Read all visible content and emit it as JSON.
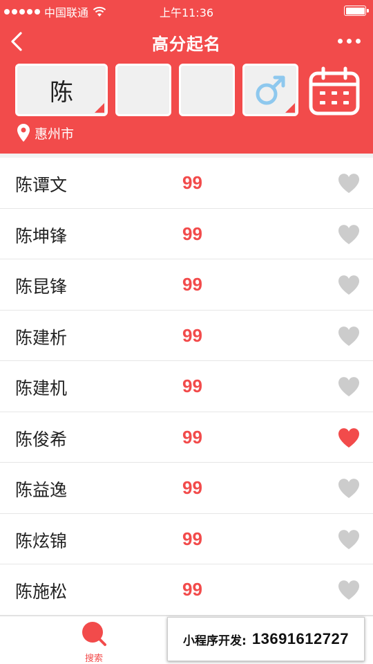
{
  "status_bar": {
    "carrier": "中国联通",
    "time": "上午11:36"
  },
  "nav": {
    "title": "高分起名"
  },
  "inputs": {
    "surname": "陈",
    "char1": "",
    "char2": ""
  },
  "location": {
    "city": "惠州市"
  },
  "names": [
    {
      "name": "陈谭文",
      "score": "99",
      "favorited": false
    },
    {
      "name": "陈坤锋",
      "score": "99",
      "favorited": false
    },
    {
      "name": "陈昆锋",
      "score": "99",
      "favorited": false
    },
    {
      "name": "陈建析",
      "score": "99",
      "favorited": false
    },
    {
      "name": "陈建机",
      "score": "99",
      "favorited": false
    },
    {
      "name": "陈俊希",
      "score": "99",
      "favorited": true
    },
    {
      "name": "陈益逸",
      "score": "99",
      "favorited": false
    },
    {
      "name": "陈炫锦",
      "score": "99",
      "favorited": false
    },
    {
      "name": "陈施松",
      "score": "99",
      "favorited": false
    }
  ],
  "tabbar": {
    "search_label": "搜索"
  },
  "promo": {
    "label": "小程序开发:",
    "phone": "13691612727"
  },
  "colors": {
    "accent": "#f24b4b",
    "male": "#8ec8ee",
    "heart_off": "#cccccc"
  }
}
